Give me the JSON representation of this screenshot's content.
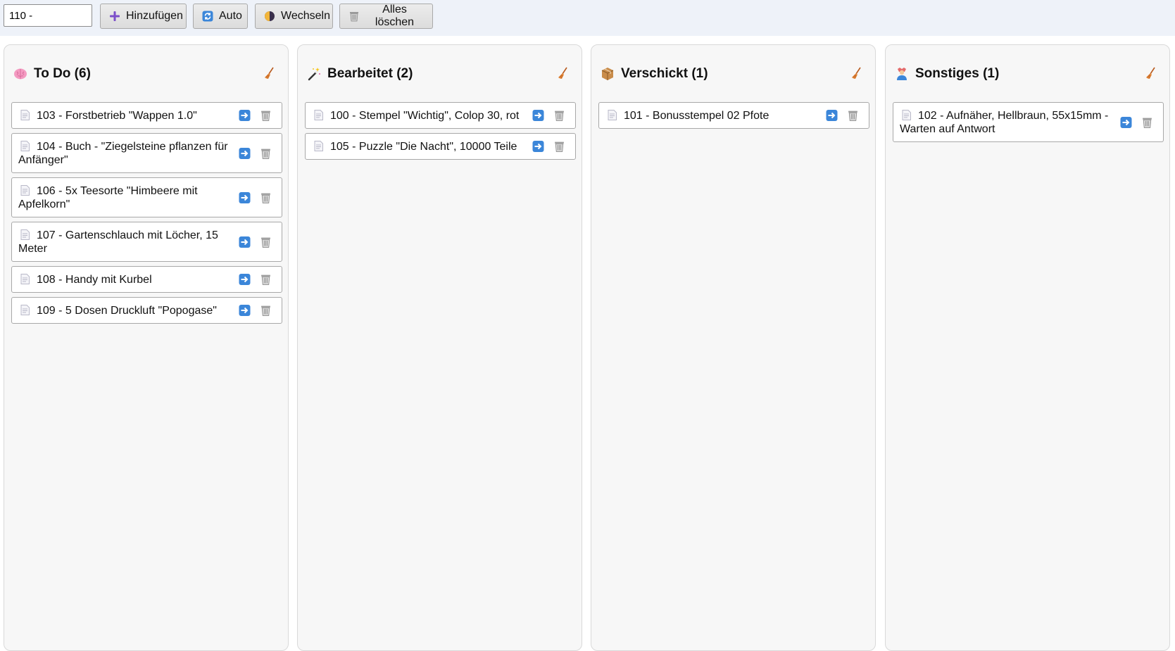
{
  "toolbar": {
    "input_value": "110 - ",
    "add_label": "Hinzufügen",
    "auto_label": "Auto",
    "switch_label": "Wechseln",
    "clear_all_label": "Alles löschen"
  },
  "columns": [
    {
      "title": "To Do (6)",
      "icon": "brain-icon",
      "cards": [
        "103 - Forstbetrieb \"Wappen 1.0\"",
        "104 - Buch - \"Ziegelsteine pflanzen für Anfänger\"",
        "106 - 5x Teesorte \"Himbeere mit Apfelkorn\"",
        "107 - Gartenschlauch mit Löcher, 15 Meter",
        "108 - Handy mit Kurbel",
        "109 - 5 Dosen Druckluft \"Popogase\""
      ]
    },
    {
      "title": "Bearbeitet (2)",
      "icon": "magic-wand-icon",
      "cards": [
        "100 - Stempel \"Wichtig\", Colop 30, rot",
        "105 - Puzzle \"Die Nacht\", 10000 Teile"
      ]
    },
    {
      "title": "Verschickt (1)",
      "icon": "package-icon",
      "cards": [
        "101 - Bonusstempel 02 Pfote"
      ]
    },
    {
      "title": "Sonstiges (1)",
      "icon": "person-icon",
      "cards": [
        "102 - Aufnäher, Hellbraun, 55x15mm - Warten auf Antwort"
      ]
    }
  ],
  "colors": {
    "toolbar_bg": "#eef2f9",
    "column_bg": "#f7f7f7",
    "move_button": "#3b86d9",
    "broom": "#d9702c"
  }
}
